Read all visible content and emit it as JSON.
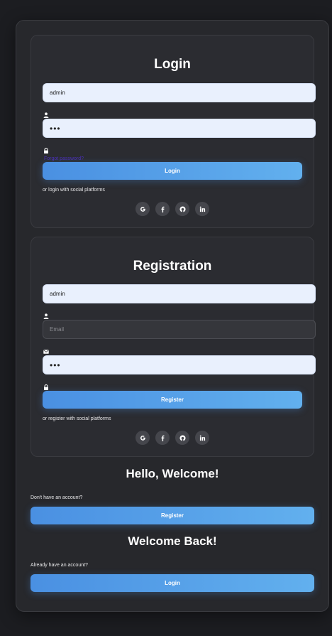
{
  "login": {
    "title": "Login",
    "username_value": "admin",
    "password_value": "•••",
    "forgot_link": "Forgot password?",
    "submit_label": "Login",
    "social_text": "or login with social platforms"
  },
  "register": {
    "title": "Registration",
    "username_value": "admin",
    "email_placeholder": "Email",
    "password_value": "•••",
    "submit_label": "Register",
    "social_text": "or register with social platforms"
  },
  "socials": [
    "G",
    "f",
    "github",
    "in"
  ],
  "toggle": {
    "welcome_title": "Hello, Welcome!",
    "welcome_text": "Don't have an account?",
    "welcome_button": "Register",
    "back_title": "Welcome Back!",
    "back_text": "Already have an account?",
    "back_button": "Login"
  },
  "colors": {
    "accent_start": "#4a90e2",
    "accent_end": "#62b0ee",
    "background": "#1c1d21",
    "panel": "#27282c"
  },
  "icons": {
    "user": "user-icon",
    "lock": "lock-icon",
    "mail": "mail-icon",
    "google": "google-icon",
    "facebook": "facebook-icon",
    "github": "github-icon",
    "linkedin": "linkedin-icon"
  }
}
